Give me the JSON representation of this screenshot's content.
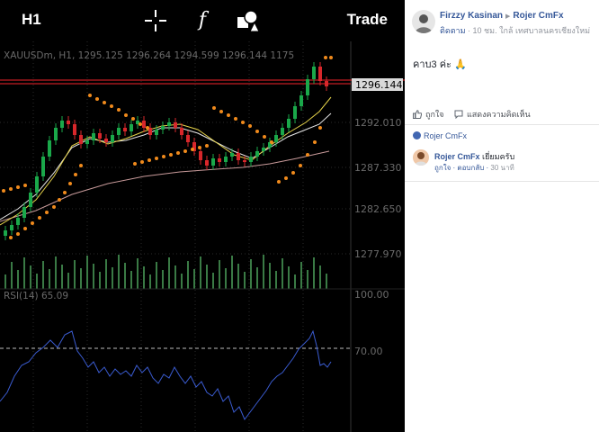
{
  "app": {
    "timeframe": "H1",
    "fx_symbol": "f",
    "trade_label": "Trade",
    "instrument_line": "XAUUSDm, H1, 1295.125 1296.264 1294.599 1296.144 1175",
    "current_price": "1296.144",
    "price_scale": [
      "1292.010",
      "1287.330",
      "1282.650",
      "1277.970"
    ],
    "rsi_header": "RSI(14) 65.09",
    "rsi_scale": [
      "100.00",
      "70.00"
    ],
    "colors": {
      "bull": "#1aa84a",
      "bear": "#d8272b",
      "sar": "#f08a1c",
      "price_line": "#c41e24",
      "rsi_line": "#3a5bd0"
    }
  },
  "post": {
    "author": "Firzzy Kasinan",
    "page": "Rojer CmFx",
    "follow_label": "ติดตาม",
    "meta": "10 ชม. ใกล้ เทศบาลนครเชียงใหม่",
    "text": "คาบ3 ค่ะ 🙏",
    "like_label": "ถูกใจ",
    "comment_label": "แสดงความคิดเห็น",
    "page_link": "Rojer CmFx",
    "reply": {
      "name": "Rojer CmFx",
      "text": "เยี่ยมครับ",
      "like": "ถูกใจ",
      "reply": "ตอบกลับ",
      "time": "30 นาที"
    }
  }
}
